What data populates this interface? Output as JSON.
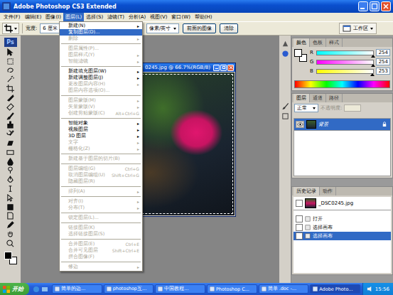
{
  "window": {
    "title": "Adobe Photoshop CS3 Extended"
  },
  "menubar": [
    {
      "label": "文件(F)",
      "selected": false
    },
    {
      "label": "编辑(E)",
      "selected": false
    },
    {
      "label": "图像(I)",
      "selected": false
    },
    {
      "label": "图层(L)",
      "selected": true
    },
    {
      "label": "选择(S)",
      "selected": false
    },
    {
      "label": "滤镜(T)",
      "selected": false
    },
    {
      "label": "分析(A)",
      "selected": false
    },
    {
      "label": "视图(V)",
      "selected": false
    },
    {
      "label": "窗口(W)",
      "selected": false
    },
    {
      "label": "帮助(H)",
      "selected": false
    }
  ],
  "options_bar": {
    "width_label": "宽度:",
    "width_value": "6 厘米",
    "resolution_unit": "像素/英寸",
    "front_image_button": "前面的图像",
    "clear_button": "清除",
    "workspace_button": "工作区"
  },
  "tools": {
    "logo": "Ps"
  },
  "layer_menu": {
    "submenu_arrow": "▸",
    "items": [
      {
        "label": "新建(N)",
        "shortcut": "",
        "submenu": true,
        "disabled": false,
        "selected": false,
        "divider_above": false
      },
      {
        "label": "复制图层(D)...",
        "shortcut": "",
        "submenu": false,
        "disabled": false,
        "selected": true,
        "divider_above": false
      },
      {
        "label": "删除",
        "shortcut": "",
        "submenu": true,
        "disabled": true,
        "selected": false,
        "divider_above": false
      },
      {
        "label": "图层属性(P)...",
        "shortcut": "",
        "submenu": false,
        "disabled": true,
        "selected": false,
        "divider_above": true
      },
      {
        "label": "图层样式(Y)",
        "shortcut": "",
        "submenu": true,
        "disabled": true,
        "selected": false,
        "divider_above": false
      },
      {
        "label": "智能滤镜",
        "shortcut": "",
        "submenu": true,
        "disabled": true,
        "selected": false,
        "divider_above": false
      },
      {
        "label": "新建填充图层(W)",
        "shortcut": "",
        "submenu": true,
        "disabled": false,
        "selected": false,
        "divider_above": true
      },
      {
        "label": "新建调整图层(J)",
        "shortcut": "",
        "submenu": true,
        "disabled": false,
        "selected": false,
        "divider_above": false
      },
      {
        "label": "更改图层内容(H)",
        "shortcut": "",
        "submenu": true,
        "disabled": true,
        "selected": false,
        "divider_above": false
      },
      {
        "label": "图层内容选项(O)...",
        "shortcut": "",
        "submenu": false,
        "disabled": true,
        "selected": false,
        "divider_above": false
      },
      {
        "label": "图层蒙版(M)",
        "shortcut": "",
        "submenu": true,
        "disabled": true,
        "selected": false,
        "divider_above": true
      },
      {
        "label": "矢量蒙版(V)",
        "shortcut": "",
        "submenu": true,
        "disabled": true,
        "selected": false,
        "divider_above": false
      },
      {
        "label": "创建剪贴蒙版(C)",
        "shortcut": "Alt+Ctrl+G",
        "submenu": false,
        "disabled": true,
        "selected": false,
        "divider_above": false
      },
      {
        "label": "智能对象",
        "shortcut": "",
        "submenu": true,
        "disabled": false,
        "selected": false,
        "divider_above": true
      },
      {
        "label": "视频图层",
        "shortcut": "",
        "submenu": true,
        "disabled": false,
        "selected": false,
        "divider_above": false
      },
      {
        "label": "3D 图层",
        "shortcut": "",
        "submenu": true,
        "disabled": false,
        "selected": false,
        "divider_above": false
      },
      {
        "label": "文字",
        "shortcut": "",
        "submenu": true,
        "disabled": true,
        "selected": false,
        "divider_above": false
      },
      {
        "label": "栅格化(Z)",
        "shortcut": "",
        "submenu": true,
        "disabled": true,
        "selected": false,
        "divider_above": false
      },
      {
        "label": "新建基于图层的切片(B)",
        "shortcut": "",
        "submenu": false,
        "disabled": true,
        "selected": false,
        "divider_above": true
      },
      {
        "label": "图层编组(G)",
        "shortcut": "Ctrl+G",
        "submenu": false,
        "disabled": true,
        "selected": false,
        "divider_above": true
      },
      {
        "label": "取消图层编组(U)",
        "shortcut": "Shift+Ctrl+G",
        "submenu": false,
        "disabled": true,
        "selected": false,
        "divider_above": false
      },
      {
        "label": "隐藏图层(R)",
        "shortcut": "",
        "submenu": false,
        "disabled": true,
        "selected": false,
        "divider_above": false
      },
      {
        "label": "排列(A)",
        "shortcut": "",
        "submenu": true,
        "disabled": true,
        "selected": false,
        "divider_above": true
      },
      {
        "label": "对齐(I)",
        "shortcut": "",
        "submenu": true,
        "disabled": true,
        "selected": false,
        "divider_above": true
      },
      {
        "label": "分布(T)",
        "shortcut": "",
        "submenu": true,
        "disabled": true,
        "selected": false,
        "divider_above": false
      },
      {
        "label": "锁定图层(L)...",
        "shortcut": "",
        "submenu": false,
        "disabled": true,
        "selected": false,
        "divider_above": true
      },
      {
        "label": "链接图层(K)",
        "shortcut": "",
        "submenu": false,
        "disabled": true,
        "selected": false,
        "divider_above": true
      },
      {
        "label": "选择链接图层(S)",
        "shortcut": "",
        "submenu": false,
        "disabled": true,
        "selected": false,
        "divider_above": false
      },
      {
        "label": "合并图层(E)",
        "shortcut": "Ctrl+E",
        "submenu": false,
        "disabled": true,
        "selected": false,
        "divider_above": true
      },
      {
        "label": "合并可见图层",
        "shortcut": "Shift+Ctrl+E",
        "submenu": false,
        "disabled": true,
        "selected": false,
        "divider_above": false
      },
      {
        "label": "拼合图像(F)",
        "shortcut": "",
        "submenu": false,
        "disabled": true,
        "selected": false,
        "divider_above": false
      },
      {
        "label": "修边",
        "shortcut": "",
        "submenu": true,
        "disabled": true,
        "selected": false,
        "divider_above": true
      }
    ]
  },
  "document": {
    "title": "0245.jpg @ 66.7%(RGB/8)"
  },
  "color_panel": {
    "tabs": [
      {
        "label": "颜色",
        "selected": true
      },
      {
        "label": "色板",
        "selected": false
      },
      {
        "label": "样式",
        "selected": false
      }
    ],
    "channels": [
      {
        "name": "R",
        "value": "254",
        "level": 0.996,
        "color": "#00fefd"
      },
      {
        "name": "G",
        "value": "254",
        "level": 0.996,
        "color": "#fe00fd"
      },
      {
        "name": "B",
        "value": "253",
        "level": 0.992,
        "color": "#fefe00"
      }
    ]
  },
  "layers_panel": {
    "tabs": [
      {
        "label": "图层",
        "selected": true
      },
      {
        "label": "通道",
        "selected": false
      },
      {
        "label": "路径",
        "selected": false
      }
    ],
    "blend_mode": "正常",
    "opacity_label": "不透明度:",
    "layers": [
      {
        "name": "背景",
        "selected": true,
        "visible": true,
        "locked": true
      }
    ]
  },
  "history_panel": {
    "tabs": [
      {
        "label": "历史记录",
        "selected": true
      },
      {
        "label": "动作",
        "selected": false
      }
    ],
    "snapshot": "_DSC0245.jpg",
    "steps": [
      {
        "label": "打开",
        "selected": false
      },
      {
        "label": "选择画布",
        "selected": false
      },
      {
        "label": "选择画布",
        "selected": true
      }
    ]
  },
  "taskbar": {
    "start": "开始",
    "tasks": [
      {
        "label": "简单的边...",
        "selected": false
      },
      {
        "label": "photoshop互...",
        "selected": false
      },
      {
        "label": "中国教程...",
        "selected": false
      },
      {
        "label": "Photoshop C...",
        "selected": false
      },
      {
        "label": "简单 .doc -...",
        "selected": false
      },
      {
        "label": "Adobe Photo...",
        "selected": true
      }
    ],
    "clock": "15:56"
  }
}
